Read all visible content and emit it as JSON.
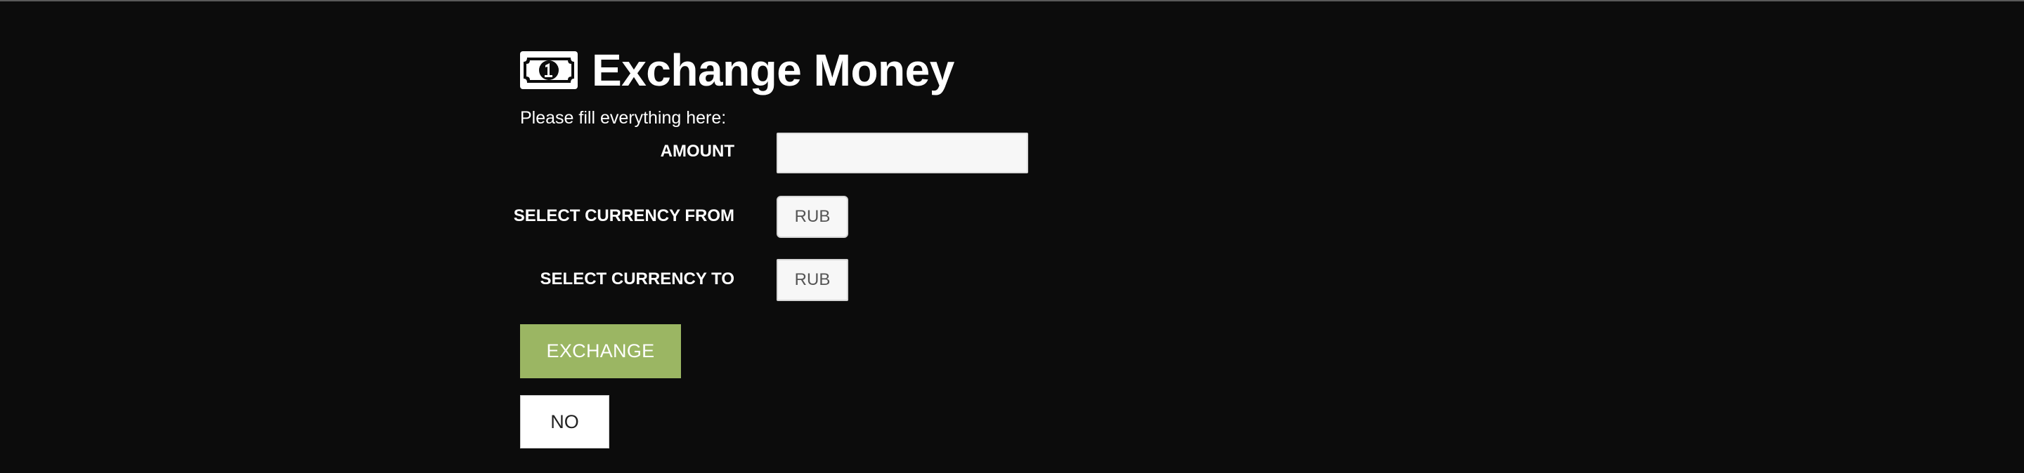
{
  "header": {
    "title": "Exchange Money",
    "icon": "money-bill-icon"
  },
  "form": {
    "intro": "Please fill everything here:",
    "amount": {
      "label": "AMOUNT",
      "value": "",
      "placeholder": ""
    },
    "currency_from": {
      "label": "SELECT CURRENCY FROM",
      "selected": "RUB"
    },
    "currency_to": {
      "label": "SELECT CURRENCY TO",
      "selected": "RUB"
    }
  },
  "actions": {
    "exchange_label": "EXCHANGE",
    "no_label": "NO"
  },
  "colors": {
    "background": "#0c0c0c",
    "exchange_button": "#9bb663",
    "text": "#ffffff"
  }
}
